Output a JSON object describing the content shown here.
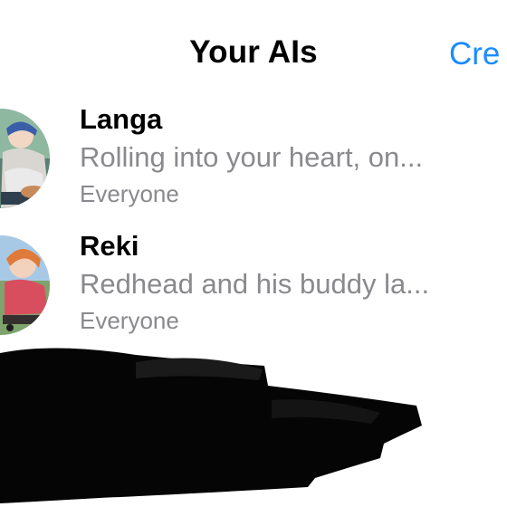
{
  "header": {
    "title": "Your AIs",
    "action_label": "Cre"
  },
  "ais": [
    {
      "name": "Langa",
      "description": "Rolling into your heart, on...",
      "visibility": "Everyone",
      "avatar_icon": "anime-avatar-langa"
    },
    {
      "name": "Reki",
      "description": "Redhead and his buddy la...",
      "visibility": "Everyone",
      "avatar_icon": "anime-avatar-reki"
    }
  ],
  "colors": {
    "accent": "#1a8cff",
    "primary_text": "#000000",
    "secondary_text": "#8a8a8e",
    "redaction": "#050505"
  }
}
